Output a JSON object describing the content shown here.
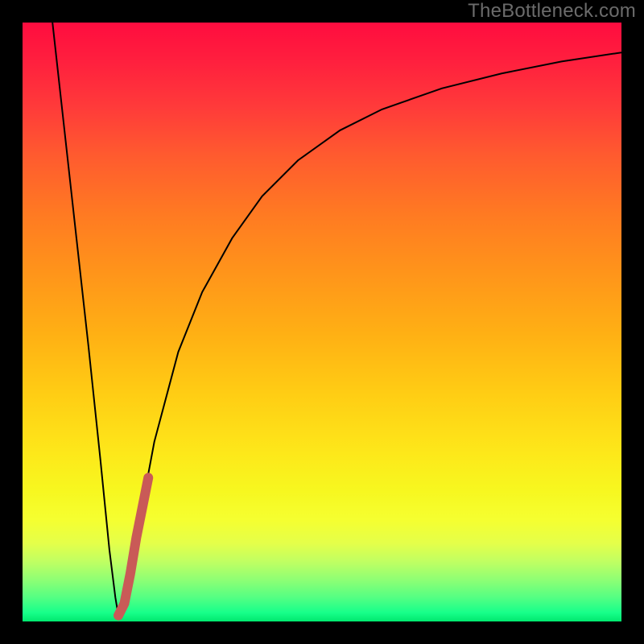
{
  "watermark": "TheBottleneck.com",
  "chart_data": {
    "type": "line",
    "title": "",
    "xlabel": "",
    "ylabel": "",
    "xlim": [
      0,
      100
    ],
    "ylim": [
      0,
      100
    ],
    "grid": false,
    "legend": false,
    "annotations": [],
    "background": {
      "gradient": "vertical",
      "top_color": "#ff0c3f",
      "bottom_color": "#00e86e",
      "meaning": "red=high bottleneck, green=low"
    },
    "series": [
      {
        "name": "bottleneck-curve",
        "color": "#000000",
        "stroke_width": 2,
        "x": [
          5,
          7,
          9,
          11,
          13,
          14.5,
          15.5,
          16,
          17,
          19,
          22,
          26,
          30,
          35,
          40,
          46,
          53,
          60,
          70,
          80,
          90,
          100
        ],
        "values": [
          100,
          82,
          64,
          46,
          27,
          12,
          4,
          1,
          3,
          14,
          30,
          45,
          55,
          64,
          71,
          77,
          82,
          85.5,
          89,
          91.5,
          93.5,
          95
        ]
      },
      {
        "name": "highlight-segment",
        "color": "#c95a57",
        "stroke_width": 12,
        "linecap": "round",
        "x": [
          16,
          17,
          18,
          19,
          20,
          21
        ],
        "values": [
          1,
          3,
          8,
          14,
          19,
          24
        ]
      }
    ]
  }
}
